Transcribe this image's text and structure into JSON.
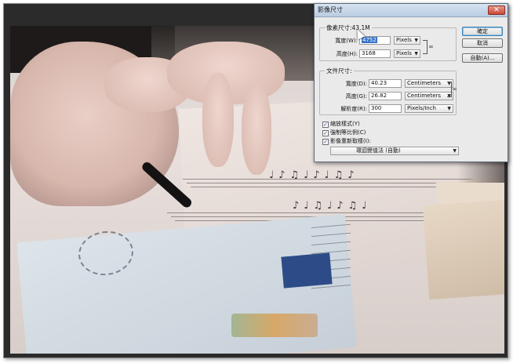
{
  "dialog": {
    "title": "影像尺寸",
    "close_icon": "✕",
    "pixel_dimensions": {
      "legend": "像素尺寸:43.1M",
      "width_label": "寬度(W):",
      "width_value": "4752",
      "width_unit": "Pixels",
      "height_label": "高度(H):",
      "height_value": "3168",
      "height_unit": "Pixels"
    },
    "document_size": {
      "legend": "文件尺寸:",
      "width_label": "寬度(D):",
      "width_value": "40.23",
      "width_unit": "Centimeters",
      "height_label": "高度(G):",
      "height_value": "26.82",
      "height_unit": "Centimeters",
      "resolution_label": "解析度(R):",
      "resolution_value": "300",
      "resolution_unit": "Pixels/Inch"
    },
    "options": {
      "scale_styles": "縮放樣式(Y)",
      "constrain_proportions": "強制等比例(C)",
      "resample": "影像重新取樣(I):",
      "resample_method": "環迴變值法 (自動)"
    },
    "buttons": {
      "ok": "確定",
      "cancel": "取消",
      "auto": "自動(A)..."
    }
  },
  "icons": {
    "link": "chain-link-icon",
    "dropdown": "▼"
  }
}
